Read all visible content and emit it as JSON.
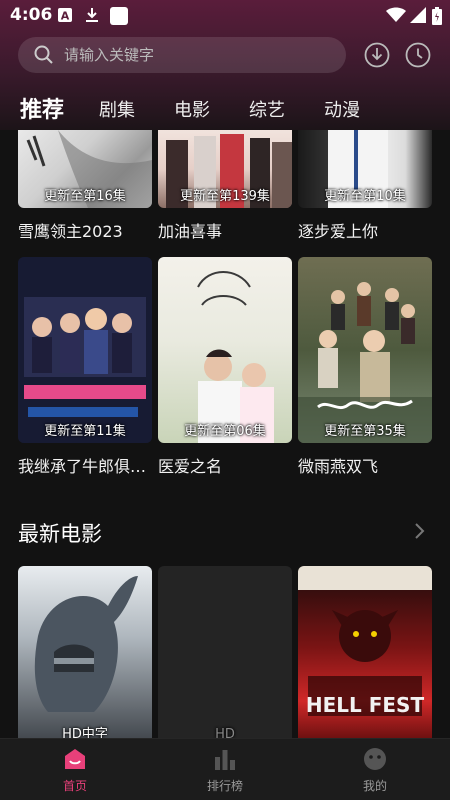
{
  "status": {
    "time": "4:06"
  },
  "search": {
    "placeholder": "请输入关键字"
  },
  "tabs": [
    "推荐",
    "剧集",
    "电影",
    "综艺",
    "动漫"
  ],
  "series_row1": [
    {
      "title": "雪鹰领主2023",
      "badge": "更新至第16集"
    },
    {
      "title": "加油喜事",
      "badge": "更新至第139集"
    },
    {
      "title": "逐步爱上你",
      "badge": "更新至第10集"
    }
  ],
  "series_row2": [
    {
      "title": "我继承了牛郎俱乐部",
      "badge": "更新至第11集"
    },
    {
      "title": "医爱之名",
      "badge": "更新至第06集"
    },
    {
      "title": "微雨燕双飞",
      "badge": "更新至第35集"
    }
  ],
  "latest_movies": {
    "title": "最新电影",
    "items": [
      {
        "badge": "HD中字"
      },
      {
        "badge": "HD"
      },
      {
        "badge": ""
      }
    ]
  },
  "bottom_nav": [
    "首页",
    "排行榜",
    "我的"
  ],
  "colors": {
    "accent": "#e8407a",
    "header": "#5a1d3b"
  }
}
